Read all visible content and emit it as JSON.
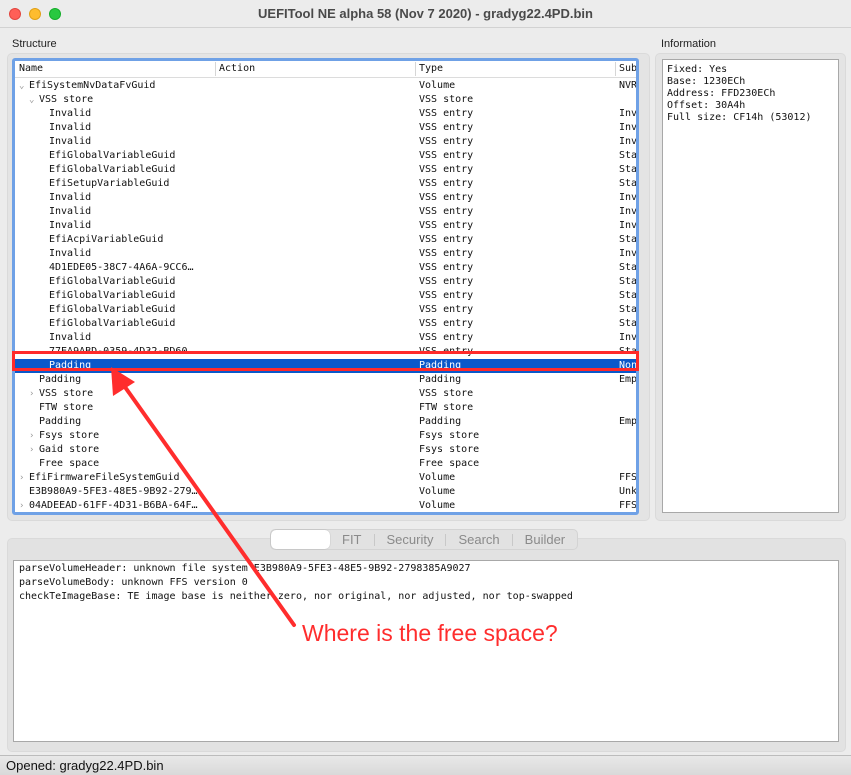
{
  "window": {
    "title": "UEFITool NE alpha 58 (Nov  7 2020) - gradyg22.4PD.bin"
  },
  "structure": {
    "label": "Structure",
    "columns": [
      "Name",
      "Action",
      "Type",
      "Subtype"
    ],
    "rows": [
      {
        "name": "EfiSystemNvDataFvGuid",
        "type": "Volume",
        "sub": "NVRAM",
        "level": 1,
        "expander": "expanded"
      },
      {
        "name": "VSS store",
        "type": "VSS store",
        "sub": "",
        "level": 2,
        "expander": "expanded"
      },
      {
        "name": "Invalid",
        "type": "VSS entry",
        "sub": "Invalid",
        "level": 3,
        "expander": ""
      },
      {
        "name": "Invalid",
        "type": "VSS entry",
        "sub": "Invalid",
        "level": 3,
        "expander": ""
      },
      {
        "name": "Invalid",
        "type": "VSS entry",
        "sub": "Invalid",
        "level": 3,
        "expander": ""
      },
      {
        "name": "EfiGlobalVariableGuid",
        "type": "VSS entry",
        "sub": "Standard",
        "level": 3,
        "expander": ""
      },
      {
        "name": "EfiGlobalVariableGuid",
        "type": "VSS entry",
        "sub": "Standard",
        "level": 3,
        "expander": ""
      },
      {
        "name": "EfiSetupVariableGuid",
        "type": "VSS entry",
        "sub": "Standard",
        "level": 3,
        "expander": ""
      },
      {
        "name": "Invalid",
        "type": "VSS entry",
        "sub": "Invalid",
        "level": 3,
        "expander": ""
      },
      {
        "name": "Invalid",
        "type": "VSS entry",
        "sub": "Invalid",
        "level": 3,
        "expander": ""
      },
      {
        "name": "Invalid",
        "type": "VSS entry",
        "sub": "Invalid",
        "level": 3,
        "expander": ""
      },
      {
        "name": "EfiAcpiVariableGuid",
        "type": "VSS entry",
        "sub": "Standard",
        "level": 3,
        "expander": ""
      },
      {
        "name": "Invalid",
        "type": "VSS entry",
        "sub": "Invalid",
        "level": 3,
        "expander": ""
      },
      {
        "name": "4D1EDE05-38C7-4A6A-9CC6…",
        "type": "VSS entry",
        "sub": "Standard",
        "level": 3,
        "expander": ""
      },
      {
        "name": "EfiGlobalVariableGuid",
        "type": "VSS entry",
        "sub": "Standard",
        "level": 3,
        "expander": ""
      },
      {
        "name": "EfiGlobalVariableGuid",
        "type": "VSS entry",
        "sub": "Standard",
        "level": 3,
        "expander": ""
      },
      {
        "name": "EfiGlobalVariableGuid",
        "type": "VSS entry",
        "sub": "Standard",
        "level": 3,
        "expander": ""
      },
      {
        "name": "EfiGlobalVariableGuid",
        "type": "VSS entry",
        "sub": "Standard",
        "level": 3,
        "expander": ""
      },
      {
        "name": "Invalid",
        "type": "VSS entry",
        "sub": "Invalid",
        "level": 3,
        "expander": ""
      },
      {
        "name": "77EA9ABD-0359-4D32-BD60…",
        "type": "VSS entry",
        "sub": "Standard",
        "level": 3,
        "expander": ""
      },
      {
        "name": "Padding",
        "type": "Padding",
        "sub": "Non-empty",
        "level": 3,
        "expander": "",
        "selected": true
      },
      {
        "name": "Padding",
        "type": "Padding",
        "sub": "Empty",
        "level": 2,
        "expander": ""
      },
      {
        "name": "VSS store",
        "type": "VSS store",
        "sub": "",
        "level": 2,
        "expander": "collapsed"
      },
      {
        "name": "FTW store",
        "type": "FTW store",
        "sub": "",
        "level": 2,
        "expander": ""
      },
      {
        "name": "Padding",
        "type": "Padding",
        "sub": "Empty",
        "level": 2,
        "expander": ""
      },
      {
        "name": "Fsys store",
        "type": "Fsys store",
        "sub": "",
        "level": 2,
        "expander": "collapsed"
      },
      {
        "name": "Gaid store",
        "type": "Fsys store",
        "sub": "",
        "level": 2,
        "expander": "collapsed"
      },
      {
        "name": "Free space",
        "type": "Free space",
        "sub": "",
        "level": 2,
        "expander": ""
      },
      {
        "name": "EfiFirmwareFileSystemGuid",
        "type": "Volume",
        "sub": "FFSv2",
        "level": 1,
        "expander": "collapsed"
      },
      {
        "name": "E3B980A9-5FE3-48E5-9B92-279…",
        "type": "Volume",
        "sub": "Unknown",
        "level": 1,
        "expander": ""
      },
      {
        "name": "04ADEEAD-61FF-4D31-B6BA-64F…",
        "type": "Volume",
        "sub": "FFSv2",
        "level": 1,
        "expander": "collapsed"
      }
    ]
  },
  "information": {
    "label": "Information",
    "text": "Fixed: Yes\nBase: 1230ECh\nAddress: FFD230ECh\nOffset: 30A4h\nFull size: CF14h (53012)"
  },
  "tabs": [
    {
      "label": "",
      "active": true
    },
    {
      "label": "FIT",
      "active": false
    },
    {
      "label": "Security",
      "active": false
    },
    {
      "label": "Search",
      "active": false
    },
    {
      "label": "Builder",
      "active": false
    }
  ],
  "messages": [
    "parseVolumeHeader: unknown file system E3B980A9-5FE3-48E5-9B92-2798385A9027",
    "parseVolumeBody: unknown FFS version 0",
    "checkTeImageBase: TE image base is neither zero, nor original, nor adjusted, nor top-swapped"
  ],
  "status": {
    "text": "Opened: gradyg22.4PD.bin"
  },
  "annotation": {
    "text": "Where is the free space?",
    "color": "#ff2d2d"
  }
}
